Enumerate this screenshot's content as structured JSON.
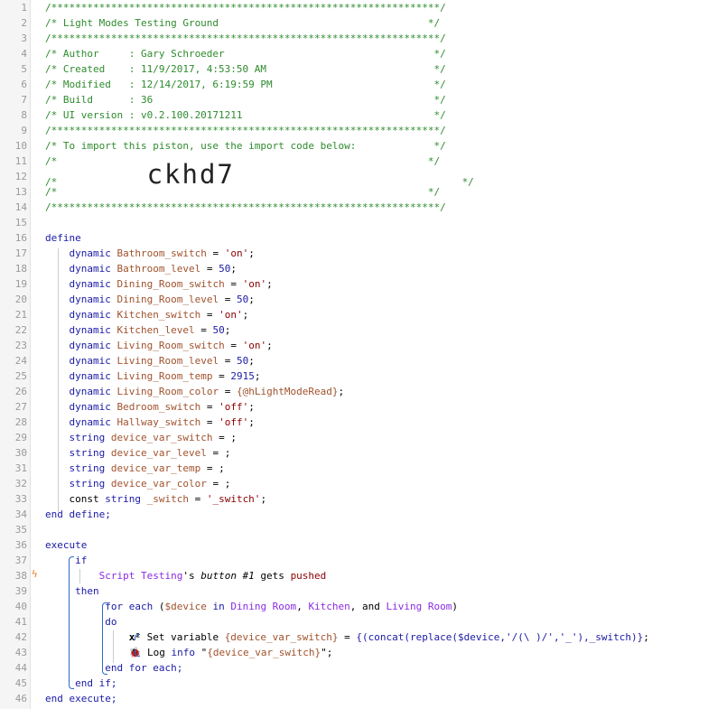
{
  "lines": [
    {
      "n": "1",
      "parts": [
        [
          "cmt",
          "/*****************************************************************/"
        ]
      ]
    },
    {
      "n": "2",
      "parts": [
        [
          "cmt",
          "/* Light Modes Testing Ground                                   */"
        ]
      ]
    },
    {
      "n": "3",
      "parts": [
        [
          "cmt",
          "/*****************************************************************/"
        ]
      ]
    },
    {
      "n": "4",
      "parts": [
        [
          "cmt",
          "/* Author     : Gary Schroeder                                   */"
        ]
      ]
    },
    {
      "n": "5",
      "parts": [
        [
          "cmt",
          "/* Created    : 11/9/2017, 4:53:50 AM                            */"
        ]
      ]
    },
    {
      "n": "6",
      "parts": [
        [
          "cmt",
          "/* Modified   : 12/14/2017, 6:19:59 PM                           */"
        ]
      ]
    },
    {
      "n": "7",
      "parts": [
        [
          "cmt",
          "/* Build      : 36                                               */"
        ]
      ]
    },
    {
      "n": "8",
      "parts": [
        [
          "cmt",
          "/* UI version : v0.2.100.20171211                                */"
        ]
      ]
    },
    {
      "n": "9",
      "parts": [
        [
          "cmt",
          "/*****************************************************************/"
        ]
      ]
    },
    {
      "n": "10",
      "parts": [
        [
          "cmt",
          "/* To import this piston, use the import code below:             */"
        ]
      ]
    },
    {
      "n": "11",
      "parts": [
        [
          "cmt",
          "/*                                                              */"
        ]
      ]
    },
    {
      "n": "12",
      "parts": [
        [
          "cmt",
          "/*               "
        ],
        [
          "big",
          "ckhd7"
        ],
        [
          "cmt",
          "                                      */"
        ]
      ]
    },
    {
      "n": "13",
      "parts": [
        [
          "cmt",
          "/*                                                              */"
        ]
      ]
    },
    {
      "n": "14",
      "parts": [
        [
          "cmt",
          "/*****************************************************************/"
        ]
      ]
    },
    {
      "n": "15",
      "parts": []
    },
    {
      "n": "16",
      "parts": [
        [
          "kw",
          "define"
        ]
      ]
    },
    {
      "n": "17",
      "parts": [
        [
          "pl",
          "    "
        ],
        [
          "kw",
          "dynamic "
        ],
        [
          "var",
          "Bathroom_switch"
        ],
        [
          "pl",
          " = "
        ],
        [
          "str",
          "'on'"
        ],
        [
          "pl",
          ";"
        ]
      ]
    },
    {
      "n": "18",
      "parts": [
        [
          "pl",
          "    "
        ],
        [
          "kw",
          "dynamic "
        ],
        [
          "var",
          "Bathroom_level"
        ],
        [
          "pl",
          " = "
        ],
        [
          "num",
          "50"
        ],
        [
          "pl",
          ";"
        ]
      ]
    },
    {
      "n": "19",
      "parts": [
        [
          "pl",
          "    "
        ],
        [
          "kw",
          "dynamic "
        ],
        [
          "var",
          "Dining_Room_switch"
        ],
        [
          "pl",
          " = "
        ],
        [
          "str",
          "'on'"
        ],
        [
          "pl",
          ";"
        ]
      ]
    },
    {
      "n": "20",
      "parts": [
        [
          "pl",
          "    "
        ],
        [
          "kw",
          "dynamic "
        ],
        [
          "var",
          "Dining_Room_level"
        ],
        [
          "pl",
          " = "
        ],
        [
          "num",
          "50"
        ],
        [
          "pl",
          ";"
        ]
      ]
    },
    {
      "n": "21",
      "parts": [
        [
          "pl",
          "    "
        ],
        [
          "kw",
          "dynamic "
        ],
        [
          "var",
          "Kitchen_switch"
        ],
        [
          "pl",
          " = "
        ],
        [
          "str",
          "'on'"
        ],
        [
          "pl",
          ";"
        ]
      ]
    },
    {
      "n": "22",
      "parts": [
        [
          "pl",
          "    "
        ],
        [
          "kw",
          "dynamic "
        ],
        [
          "var",
          "Kitchen_level"
        ],
        [
          "pl",
          " = "
        ],
        [
          "num",
          "50"
        ],
        [
          "pl",
          ";"
        ]
      ]
    },
    {
      "n": "23",
      "parts": [
        [
          "pl",
          "    "
        ],
        [
          "kw",
          "dynamic "
        ],
        [
          "var",
          "Living_Room_switch"
        ],
        [
          "pl",
          " = "
        ],
        [
          "str",
          "'on'"
        ],
        [
          "pl",
          ";"
        ]
      ]
    },
    {
      "n": "24",
      "parts": [
        [
          "pl",
          "    "
        ],
        [
          "kw",
          "dynamic "
        ],
        [
          "var",
          "Living_Room_level"
        ],
        [
          "pl",
          " = "
        ],
        [
          "num",
          "50"
        ],
        [
          "pl",
          ";"
        ]
      ]
    },
    {
      "n": "25",
      "parts": [
        [
          "pl",
          "    "
        ],
        [
          "kw",
          "dynamic "
        ],
        [
          "var",
          "Living_Room_temp"
        ],
        [
          "pl",
          " = "
        ],
        [
          "num",
          "2915"
        ],
        [
          "pl",
          ";"
        ]
      ]
    },
    {
      "n": "26",
      "parts": [
        [
          "pl",
          "    "
        ],
        [
          "kw",
          "dynamic "
        ],
        [
          "var",
          "Living_Room_color"
        ],
        [
          "pl",
          " = "
        ],
        [
          "var",
          "{@hLightModeRead}"
        ],
        [
          "pl",
          ";"
        ]
      ]
    },
    {
      "n": "27",
      "parts": [
        [
          "pl",
          "    "
        ],
        [
          "kw",
          "dynamic "
        ],
        [
          "var",
          "Bedroom_switch"
        ],
        [
          "pl",
          " = "
        ],
        [
          "str",
          "'off'"
        ],
        [
          "pl",
          ";"
        ]
      ]
    },
    {
      "n": "28",
      "parts": [
        [
          "pl",
          "    "
        ],
        [
          "kw",
          "dynamic "
        ],
        [
          "var",
          "Hallway_switch"
        ],
        [
          "pl",
          " = "
        ],
        [
          "str",
          "'off'"
        ],
        [
          "pl",
          ";"
        ]
      ]
    },
    {
      "n": "29",
      "parts": [
        [
          "pl",
          "    "
        ],
        [
          "kw",
          "string "
        ],
        [
          "var",
          "device_var_switch"
        ],
        [
          "pl",
          " = ;"
        ]
      ]
    },
    {
      "n": "30",
      "parts": [
        [
          "pl",
          "    "
        ],
        [
          "kw",
          "string "
        ],
        [
          "var",
          "device_var_level"
        ],
        [
          "pl",
          " = ;"
        ]
      ]
    },
    {
      "n": "31",
      "parts": [
        [
          "pl",
          "    "
        ],
        [
          "kw",
          "string "
        ],
        [
          "var",
          "device_var_temp"
        ],
        [
          "pl",
          " = ;"
        ]
      ]
    },
    {
      "n": "32",
      "parts": [
        [
          "pl",
          "    "
        ],
        [
          "kw",
          "string "
        ],
        [
          "var",
          "device_var_color"
        ],
        [
          "pl",
          " = ;"
        ]
      ]
    },
    {
      "n": "33",
      "parts": [
        [
          "pl",
          "    const "
        ],
        [
          "kw",
          "string "
        ],
        [
          "var",
          "_switch"
        ],
        [
          "pl",
          " = "
        ],
        [
          "str",
          "'_switch'"
        ],
        [
          "pl",
          ";"
        ]
      ]
    },
    {
      "n": "34",
      "parts": [
        [
          "kw",
          "end define;"
        ]
      ]
    },
    {
      "n": "35",
      "parts": []
    },
    {
      "n": "36",
      "parts": [
        [
          "kw",
          "execute"
        ]
      ]
    },
    {
      "n": "37",
      "parts": [
        [
          "pl",
          "     "
        ],
        [
          "kw",
          "if"
        ]
      ]
    },
    {
      "n": "38",
      "parts": [
        [
          "pl",
          "         "
        ],
        [
          "dev",
          "Script Testing"
        ],
        [
          "pl",
          "'s "
        ],
        [
          "it",
          "button #1"
        ],
        [
          "pl",
          " gets "
        ],
        [
          "str",
          "pushed"
        ]
      ]
    },
    {
      "n": "39",
      "parts": [
        [
          "pl",
          "     "
        ],
        [
          "kw",
          "then"
        ]
      ]
    },
    {
      "n": "40",
      "parts": [
        [
          "pl",
          "          "
        ],
        [
          "kw",
          "for each "
        ],
        [
          "pl",
          "("
        ],
        [
          "var",
          "$device"
        ],
        [
          "kw",
          " in "
        ],
        [
          "dev",
          "Dining Room"
        ],
        [
          "pl",
          ", "
        ],
        [
          "dev",
          "Kitchen"
        ],
        [
          "pl",
          ", and "
        ],
        [
          "dev",
          "Living Room"
        ],
        [
          "pl",
          ")"
        ]
      ]
    },
    {
      "n": "41",
      "parts": [
        [
          "pl",
          "          "
        ],
        [
          "kw",
          "do"
        ]
      ]
    },
    {
      "n": "42",
      "parts": [
        [
          "pl",
          "              "
        ],
        [
          "x2",
          "x²"
        ],
        [
          "pl",
          " Set variable "
        ],
        [
          "var",
          "{device_var_switch}"
        ],
        [
          "pl",
          " = "
        ],
        [
          "kw",
          "{(concat(replace($device,'/(\\ )/','_'),_switch)}"
        ],
        [
          "pl",
          ";"
        ]
      ]
    },
    {
      "n": "43",
      "parts": [
        [
          "pl",
          "              "
        ],
        [
          "pl",
          "🐞 Log "
        ],
        [
          "kw",
          "info"
        ],
        [
          "pl",
          " \""
        ],
        [
          "var",
          "{device_var_switch}"
        ],
        [
          "pl",
          "\";"
        ]
      ]
    },
    {
      "n": "44",
      "parts": [
        [
          "pl",
          "          "
        ],
        [
          "kw",
          "end for each;"
        ]
      ]
    },
    {
      "n": "45",
      "parts": [
        [
          "pl",
          "     "
        ],
        [
          "kw",
          "end if;"
        ]
      ]
    },
    {
      "n": "46",
      "parts": [
        [
          "kw",
          "end execute;"
        ]
      ]
    }
  ],
  "warning_icon": "lightning-icon",
  "warning_glyph": "ϟ"
}
